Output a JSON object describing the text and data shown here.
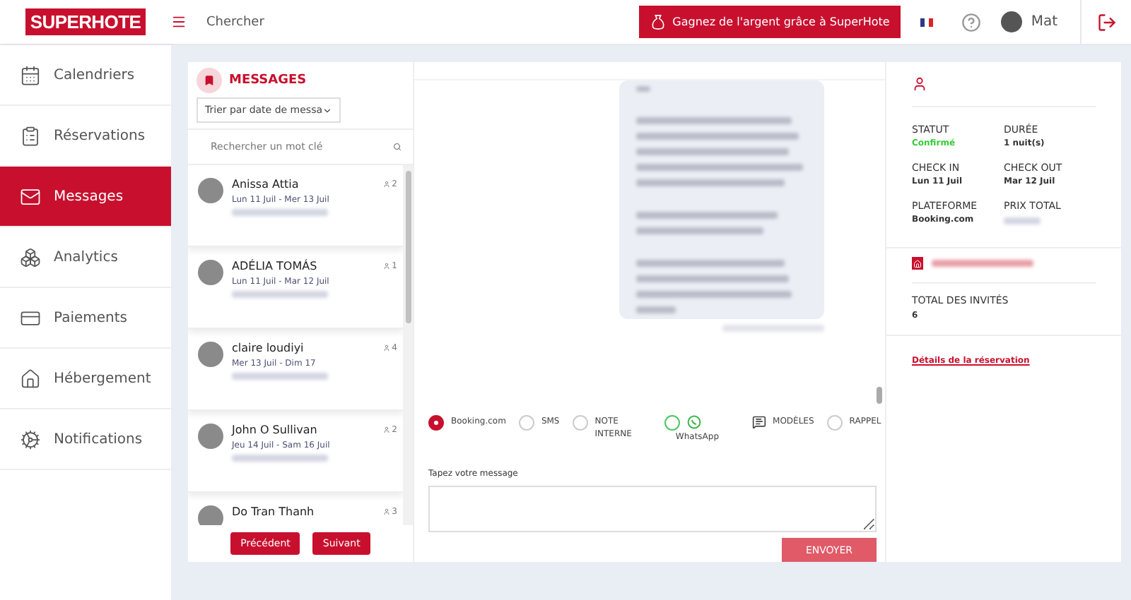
{
  "topbar": {
    "logo": "SUPERHOTE",
    "search_label": "Chercher",
    "promo_button": "Gagnez de l'argent grâce à SuperHote",
    "user_name": "Mat"
  },
  "sidebar": {
    "items": [
      {
        "label": "Calendriers",
        "selected": false
      },
      {
        "label": "Réservations",
        "selected": false
      },
      {
        "label": "Messages",
        "selected": true
      },
      {
        "label": "Analytics",
        "selected": false
      },
      {
        "label": "Paiements",
        "selected": false
      },
      {
        "label": "Hébergement",
        "selected": false
      },
      {
        "label": "Notifications",
        "selected": false
      }
    ]
  },
  "conversations": {
    "title": "MESSAGES",
    "sort": "Trier par date de messa",
    "search_placeholder": "Rechercher un mot clé",
    "items": [
      {
        "name": "Anissa Attia",
        "dates": "Lun 11 Juil - Mer 13 Juil",
        "count": "2"
      },
      {
        "name": "ADÉLIA TOMÁS",
        "dates": "Lun 11 Juil - Mar 12 Juil",
        "count": "1"
      },
      {
        "name": "claire loudiyi",
        "dates": "Mer 13 Juil - Dim 17",
        "count": "4"
      },
      {
        "name": "John O Sullivan",
        "dates": "Jeu 14 Juil - Sam 16 Juil",
        "count": "2"
      },
      {
        "name": "Do Tran Thanh",
        "count": "3"
      }
    ],
    "buttons": [
      "Précédent",
      "Suivant"
    ]
  },
  "composer": {
    "channels": [
      {
        "kind": "radio",
        "label": "Booking.com",
        "selected": true
      },
      {
        "kind": "radio",
        "label": "SMS",
        "selected": false
      },
      {
        "kind": "radio",
        "label": "NOTE INTERNE",
        "selected": false
      },
      {
        "kind": "whatsapp",
        "label": "WhatsApp",
        "selected": false
      },
      {
        "kind": "templates",
        "label": "MODÈLES"
      },
      {
        "kind": "radio",
        "label": "RAPPEL",
        "selected": false
      }
    ],
    "message_label": "Tapez votre message",
    "send_button": "ENVOYER"
  },
  "details": {
    "fields": [
      {
        "label": "STATUT",
        "value": "Confirmé",
        "kind": "status"
      },
      {
        "label": "DURÉE",
        "value": "1 nuit(s)",
        "kind": "text"
      },
      {
        "label": "CHECK IN",
        "value": "Lun 11 Juil",
        "kind": "text"
      },
      {
        "label": "CHECK OUT",
        "value": "Mar 12 Juil",
        "kind": "text"
      },
      {
        "label": "PLATEFORME",
        "value": "Booking.com",
        "kind": "text"
      },
      {
        "label": "PRIX TOTAL",
        "kind": "hidden"
      }
    ],
    "guests_label": "TOTAL DES INVITÉS",
    "guests_value": "6",
    "link": "Détails de la réservation"
  }
}
